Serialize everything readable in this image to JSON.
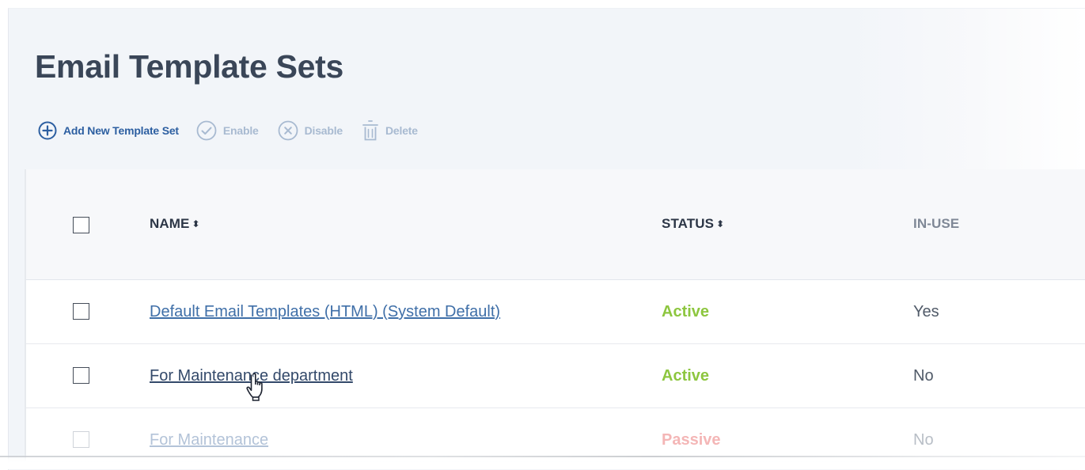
{
  "page": {
    "title": "Email Template Sets"
  },
  "toolbar": {
    "add_label": "Add New Template Set",
    "enable_label": "Enable",
    "disable_label": "Disable",
    "delete_label": "Delete"
  },
  "table": {
    "columns": [
      {
        "label": "NAME",
        "sortable": true
      },
      {
        "label": "STATUS",
        "sortable": true
      },
      {
        "label": "IN-USE",
        "sortable": false
      }
    ],
    "rows": [
      {
        "name": "Default Email Templates (HTML) (System Default)",
        "status": "Active",
        "in_use": "Yes"
      },
      {
        "name": "For Maintenance department",
        "status": "Active",
        "in_use": "No"
      },
      {
        "name": "For Maintenance",
        "status": "Passive",
        "in_use": "No"
      }
    ]
  },
  "colors": {
    "link": "#3f6fa8",
    "active": "#8dc63f",
    "passive": "#f08a8a",
    "toolbar_primary": "#2d5fa1",
    "toolbar_disabled": "#a8bad1"
  },
  "icons": [
    "plus-circle-icon",
    "check-circle-icon",
    "x-circle-icon",
    "trash-icon",
    "sort-icon",
    "hand-pointer-icon"
  ]
}
